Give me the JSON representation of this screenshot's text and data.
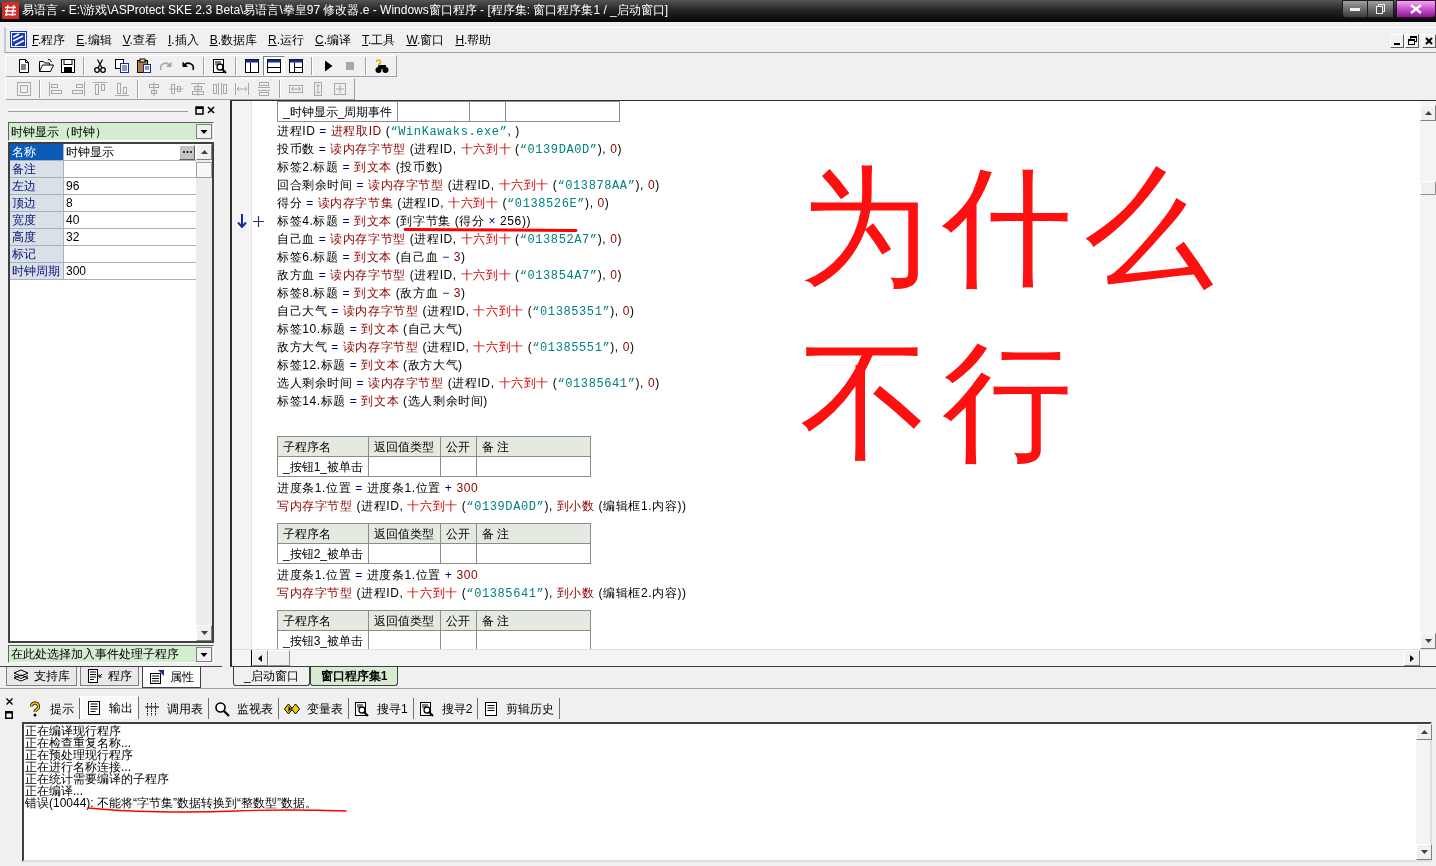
{
  "window": {
    "title": "易语言 - E:\\游戏\\ASProtect SKE 2.3 Beta\\易语言\\拳皇97 修改器.e - Windows窗口程序 - [程序集: 窗口程序集1 / _启动窗口]"
  },
  "menu": [
    "F.程序",
    "E.编辑",
    "V.查看",
    "I.插入",
    "B.数据库",
    "R.运行",
    "C.编译",
    "T.工具",
    "W.窗口",
    "H.帮助"
  ],
  "toolbars": {
    "main": [
      [
        {
          "disabled": false,
          "pressed": false
        },
        {
          "disabled": false,
          "pressed": false
        },
        {
          "disabled": false,
          "pressed": false
        }
      ],
      [
        {
          "disabled": false,
          "pressed": false
        },
        {
          "disabled": false,
          "pressed": false
        },
        {
          "disabled": false,
          "pressed": false
        },
        {
          "disabled": true,
          "pressed": false
        },
        {
          "disabled": false,
          "pressed": false
        }
      ],
      [
        {
          "disabled": false,
          "pressed": false
        }
      ],
      [
        {
          "disabled": false,
          "pressed": false
        },
        {
          "disabled": false,
          "pressed": true
        },
        {
          "disabled": false,
          "pressed": false
        }
      ],
      [
        {
          "disabled": false,
          "pressed": false
        },
        {
          "disabled": true,
          "pressed": false
        }
      ],
      [
        {
          "disabled": false,
          "pressed": false
        }
      ]
    ],
    "layout": [
      [
        {
          "disabled": true
        }
      ],
      [
        {
          "disabled": true
        },
        {
          "disabled": true
        },
        {
          "disabled": true
        },
        {
          "disabled": true
        }
      ],
      [
        {
          "disabled": true
        },
        {
          "disabled": true
        },
        {
          "disabled": true
        },
        {
          "disabled": true
        },
        {
          "disabled": true
        },
        {
          "disabled": true
        }
      ],
      [
        {
          "disabled": true
        },
        {
          "disabled": true
        },
        {
          "disabled": true
        }
      ]
    ]
  },
  "properties": {
    "object": "时钟显示（时钟）",
    "rows": [
      {
        "label": "名称",
        "value": "时钟显示",
        "selected": true
      },
      {
        "label": "备注",
        "selected": false
      },
      {
        "label": "左边",
        "value": "96",
        "selected": false
      },
      {
        "label": "顶边",
        "value": "8",
        "selected": false
      },
      {
        "label": "宽度",
        "value": "40",
        "selected": false
      },
      {
        "label": "高度",
        "value": "32",
        "selected": false
      },
      {
        "label": "标记",
        "selected": false
      },
      {
        "label": "时钟周期",
        "value": "300",
        "selected": false
      }
    ],
    "event_picker": "在此处选择加入事件处理子程序",
    "tabs": [
      {
        "label": "支持库",
        "selected": false
      },
      {
        "label": "程序",
        "selected": false
      },
      {
        "label": "属性",
        "selected": true
      }
    ]
  },
  "editor": {
    "subs": [
      {
        "name": "_时钟显示_周期事件",
        "lines": [
          {
            "marked": false,
            "tokens": [
              {
                "text": "进程ID",
                "kind": "var"
              },
              {
                "text": " = ",
                "kind": "op"
              },
              {
                "text": "进程取ID",
                "kind": "cmd"
              },
              {
                "text": " (",
                "kind": "var"
              },
              {
                "text": "“WinKawaks.exe”",
                "kind": "str"
              },
              {
                "text": ", )",
                "kind": "var"
              }
            ]
          },
          {
            "marked": false,
            "tokens": [
              {
                "text": "投币数",
                "kind": "var"
              },
              {
                "text": " = ",
                "kind": "op"
              },
              {
                "text": "读内存字节型",
                "kind": "cmd"
              },
              {
                "text": " (进程ID, ",
                "kind": "var"
              },
              {
                "text": "十六到十",
                "kind": "lib"
              },
              {
                "text": " (",
                "kind": "var"
              },
              {
                "text": "“0139DA0D”",
                "kind": "str"
              },
              {
                "text": "), ",
                "kind": "var"
              },
              {
                "text": "0",
                "kind": "num"
              },
              {
                "text": ")",
                "kind": "var"
              }
            ]
          },
          {
            "marked": false,
            "tokens": [
              {
                "text": "标签2.标题",
                "kind": "var"
              },
              {
                "text": " = ",
                "kind": "op"
              },
              {
                "text": "到文本",
                "kind": "cmd"
              },
              {
                "text": " (投币数)",
                "kind": "var"
              }
            ]
          },
          {
            "marked": false,
            "tokens": [
              {
                "text": "回合剩余时间",
                "kind": "var"
              },
              {
                "text": " = ",
                "kind": "op"
              },
              {
                "text": "读内存字节型",
                "kind": "cmd"
              },
              {
                "text": " (进程ID, ",
                "kind": "var"
              },
              {
                "text": "十六到十",
                "kind": "lib"
              },
              {
                "text": " (",
                "kind": "var"
              },
              {
                "text": "“013878AA”",
                "kind": "str"
              },
              {
                "text": "), ",
                "kind": "var"
              },
              {
                "text": "0",
                "kind": "num"
              },
              {
                "text": ")",
                "kind": "var"
              }
            ]
          },
          {
            "marked": false,
            "tokens": [
              {
                "text": "得分",
                "kind": "var"
              },
              {
                "text": " = ",
                "kind": "op"
              },
              {
                "text": "读内存字节集",
                "kind": "cmd"
              },
              {
                "text": " (进程ID, ",
                "kind": "var"
              },
              {
                "text": "十六到十",
                "kind": "lib"
              },
              {
                "text": " (",
                "kind": "var"
              },
              {
                "text": "“0138526E”",
                "kind": "str"
              },
              {
                "text": "), ",
                "kind": "var"
              },
              {
                "text": "0",
                "kind": "num"
              },
              {
                "text": ")",
                "kind": "var"
              }
            ]
          },
          {
            "marked": true,
            "tokens": [
              {
                "text": "标签4.标题",
                "kind": "var"
              },
              {
                "text": " = ",
                "kind": "op"
              },
              {
                "text": "到文本",
                "kind": "cmd"
              },
              {
                "text": " (到字节集 (得分",
                "kind": "var"
              },
              {
                "text": " × ",
                "kind": "op"
              },
              {
                "text": "256))",
                "kind": "var"
              }
            ]
          },
          {
            "marked": false,
            "tokens": [
              {
                "text": "自己血",
                "kind": "var"
              },
              {
                "text": " = ",
                "kind": "op"
              },
              {
                "text": "读内存字节型",
                "kind": "cmd"
              },
              {
                "text": " (进程ID, ",
                "kind": "var"
              },
              {
                "text": "十六到十",
                "kind": "lib"
              },
              {
                "text": " (",
                "kind": "var"
              },
              {
                "text": "“013852A7”",
                "kind": "str"
              },
              {
                "text": "), ",
                "kind": "var"
              },
              {
                "text": "0",
                "kind": "num"
              },
              {
                "text": ")",
                "kind": "var"
              }
            ]
          },
          {
            "marked": false,
            "tokens": [
              {
                "text": "标签6.标题",
                "kind": "var"
              },
              {
                "text": " = ",
                "kind": "op"
              },
              {
                "text": "到文本",
                "kind": "cmd"
              },
              {
                "text": " (自己血",
                "kind": "var"
              },
              {
                "text": " − ",
                "kind": "op"
              },
              {
                "text": "3",
                "kind": "num"
              },
              {
                "text": ")",
                "kind": "var"
              }
            ]
          },
          {
            "marked": false,
            "tokens": [
              {
                "text": "敌方血",
                "kind": "var"
              },
              {
                "text": " = ",
                "kind": "op"
              },
              {
                "text": "读内存字节型",
                "kind": "cmd"
              },
              {
                "text": " (进程ID, ",
                "kind": "var"
              },
              {
                "text": "十六到十",
                "kind": "lib"
              },
              {
                "text": " (",
                "kind": "var"
              },
              {
                "text": "“013854A7”",
                "kind": "str"
              },
              {
                "text": "), ",
                "kind": "var"
              },
              {
                "text": "0",
                "kind": "num"
              },
              {
                "text": ")",
                "kind": "var"
              }
            ]
          },
          {
            "marked": false,
            "tokens": [
              {
                "text": "标签8.标题",
                "kind": "var"
              },
              {
                "text": " = ",
                "kind": "op"
              },
              {
                "text": "到文本",
                "kind": "cmd"
              },
              {
                "text": " (敌方血",
                "kind": "var"
              },
              {
                "text": " − ",
                "kind": "op"
              },
              {
                "text": "3",
                "kind": "num"
              },
              {
                "text": ")",
                "kind": "var"
              }
            ]
          },
          {
            "marked": false,
            "tokens": [
              {
                "text": "自己大气",
                "kind": "var"
              },
              {
                "text": " = ",
                "kind": "op"
              },
              {
                "text": "读内存字节型",
                "kind": "cmd"
              },
              {
                "text": " (进程ID, ",
                "kind": "var"
              },
              {
                "text": "十六到十",
                "kind": "lib"
              },
              {
                "text": " (",
                "kind": "var"
              },
              {
                "text": "“01385351”",
                "kind": "str"
              },
              {
                "text": "), ",
                "kind": "var"
              },
              {
                "text": "0",
                "kind": "num"
              },
              {
                "text": ")",
                "kind": "var"
              }
            ]
          },
          {
            "marked": false,
            "tokens": [
              {
                "text": "标签10.标题",
                "kind": "var"
              },
              {
                "text": " = ",
                "kind": "op"
              },
              {
                "text": "到文本",
                "kind": "cmd"
              },
              {
                "text": " (自己大气)",
                "kind": "var"
              }
            ]
          },
          {
            "marked": false,
            "tokens": [
              {
                "text": "敌方大气",
                "kind": "var"
              },
              {
                "text": " = ",
                "kind": "op"
              },
              {
                "text": "读内存字节型",
                "kind": "cmd"
              },
              {
                "text": " (进程ID, ",
                "kind": "var"
              },
              {
                "text": "十六到十",
                "kind": "lib"
              },
              {
                "text": " (",
                "kind": "var"
              },
              {
                "text": "“01385551”",
                "kind": "str"
              },
              {
                "text": "), ",
                "kind": "var"
              },
              {
                "text": "0",
                "kind": "num"
              },
              {
                "text": ")",
                "kind": "var"
              }
            ]
          },
          {
            "marked": false,
            "tokens": [
              {
                "text": "标签12.标题",
                "kind": "var"
              },
              {
                "text": " = ",
                "kind": "op"
              },
              {
                "text": "到文本",
                "kind": "cmd"
              },
              {
                "text": " (敌方大气)",
                "kind": "var"
              }
            ]
          },
          {
            "marked": false,
            "tokens": [
              {
                "text": "选人剩余时间",
                "kind": "var"
              },
              {
                "text": " = ",
                "kind": "op"
              },
              {
                "text": "读内存字节型",
                "kind": "cmd"
              },
              {
                "text": " (进程ID, ",
                "kind": "var"
              },
              {
                "text": "十六到十",
                "kind": "lib"
              },
              {
                "text": " (",
                "kind": "var"
              },
              {
                "text": "“01385641”",
                "kind": "str"
              },
              {
                "text": "), ",
                "kind": "var"
              },
              {
                "text": "0",
                "kind": "num"
              },
              {
                "text": ")",
                "kind": "var"
              }
            ]
          },
          {
            "marked": false,
            "tokens": [
              {
                "text": "标签14.标题",
                "kind": "var"
              },
              {
                "text": " = ",
                "kind": "op"
              },
              {
                "text": "到文本",
                "kind": "cmd"
              },
              {
                "text": " (选人剩余时间)",
                "kind": "var"
              }
            ]
          }
        ]
      },
      {
        "columns": [
          "子程序名",
          "返回值类型",
          "公开",
          "备 注"
        ],
        "name": "_按钮1_被单击",
        "lines": [
          {
            "marked": false,
            "tokens": [
              {
                "text": "进度条1.位置",
                "kind": "var"
              },
              {
                "text": " = ",
                "kind": "op"
              },
              {
                "text": "进度条1.位置",
                "kind": "var"
              },
              {
                "text": " + ",
                "kind": "op"
              },
              {
                "text": "300",
                "kind": "num"
              }
            ]
          },
          {
            "marked": false,
            "tokens": [
              {
                "text": "写内存字节型",
                "kind": "cmd"
              },
              {
                "text": " (进程ID, ",
                "kind": "var"
              },
              {
                "text": "十六到十",
                "kind": "lib"
              },
              {
                "text": " (",
                "kind": "var"
              },
              {
                "text": "“0139DA0D”",
                "kind": "str"
              },
              {
                "text": "), ",
                "kind": "var"
              },
              {
                "text": "到小数",
                "kind": "cmd"
              },
              {
                "text": " (编辑框1.内容))",
                "kind": "var"
              }
            ]
          }
        ]
      },
      {
        "columns": [
          "子程序名",
          "返回值类型",
          "公开",
          "备 注"
        ],
        "name": "_按钮2_被单击",
        "lines": [
          {
            "marked": false,
            "tokens": [
              {
                "text": "进度条1.位置",
                "kind": "var"
              },
              {
                "text": " = ",
                "kind": "op"
              },
              {
                "text": "进度条1.位置",
                "kind": "var"
              },
              {
                "text": " + ",
                "kind": "op"
              },
              {
                "text": "300",
                "kind": "num"
              }
            ]
          },
          {
            "marked": false,
            "tokens": [
              {
                "text": "写内存字节型",
                "kind": "cmd"
              },
              {
                "text": " (进程ID, ",
                "kind": "var"
              },
              {
                "text": "十六到十",
                "kind": "lib"
              },
              {
                "text": " (",
                "kind": "var"
              },
              {
                "text": "“01385641”",
                "kind": "str"
              },
              {
                "text": "), ",
                "kind": "var"
              },
              {
                "text": "到小数",
                "kind": "cmd"
              },
              {
                "text": " (编辑框2.内容))",
                "kind": "var"
              }
            ]
          }
        ]
      },
      {
        "columns": [
          "子程序名",
          "返回值类型",
          "公开",
          "备 注"
        ],
        "name": "_按钮3_被单击"
      }
    ],
    "tabs": [
      {
        "label": "_启动窗口",
        "selected": false
      },
      {
        "label": "窗口程序集1",
        "selected": true
      }
    ]
  },
  "output": {
    "tabs": [
      {
        "label": "提示",
        "selected": false
      },
      {
        "label": "输出",
        "selected": true
      },
      {
        "label": "调用表",
        "selected": false
      },
      {
        "label": "监视表",
        "selected": false
      },
      {
        "label": "变量表",
        "selected": false
      },
      {
        "label": "搜寻1",
        "selected": false
      },
      {
        "label": "搜寻2",
        "selected": false
      },
      {
        "label": "剪辑历史",
        "selected": false
      }
    ],
    "lines": [
      "正在编译现行程序",
      "正在检查重复名称...",
      "正在预处理现行程序",
      "正在进行名称连接...",
      "正在统计需要编译的子程序",
      "正在编译...",
      "错误(10044): 不能将“字节集”数据转换到“整数型”数据。"
    ]
  },
  "annotation": {
    "lines": [
      "为什么",
      "不行"
    ]
  }
}
